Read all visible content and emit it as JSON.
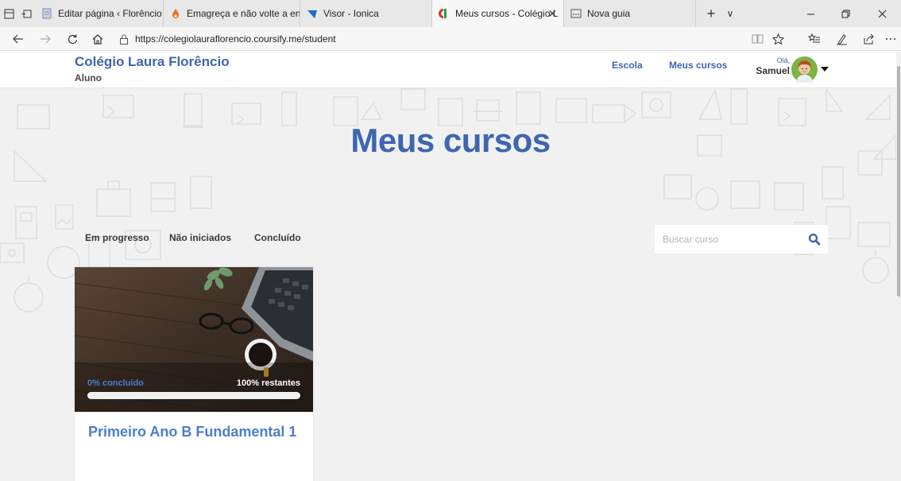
{
  "browser": {
    "tabs": [
      {
        "label": "Editar página ‹ Florêncio Sis",
        "icon": "document-icon",
        "active": false
      },
      {
        "label": "Emagreça e não volte a eng",
        "icon": "flame-icon",
        "active": false
      },
      {
        "label": "Visor - Ionica",
        "icon": "ionica-icon",
        "active": false
      },
      {
        "label": "Meus cursos - Colégio L",
        "icon": "coursify-icon",
        "active": true
      },
      {
        "label": "Nova guia",
        "icon": "newtab-icon",
        "active": false
      }
    ],
    "close_tab_glyph": "✕",
    "new_tab_glyph": "+",
    "tab_list_glyph": "∨",
    "url": "https://colegiolauraflorencio.coursify.me/student",
    "accent_color": "#3e66b0"
  },
  "site": {
    "brand_name": "Colégio Laura Florêncio",
    "brand_sub": "Aluno",
    "nav": {
      "school": "Escola",
      "my_courses": "Meus cursos"
    },
    "user": {
      "greeting": "Olá,",
      "name": "Samuel"
    }
  },
  "hero": {
    "title": "Meus cursos"
  },
  "filters": {
    "in_progress": "Em progresso",
    "not_started": "Não iniciados",
    "completed": "Concluído"
  },
  "search": {
    "placeholder": "Buscar curso",
    "value": ""
  },
  "courses": [
    {
      "title": "Primeiro Ano B Fundamental 1",
      "completed_label": "0% concluído",
      "remaining_label": "100% restantes",
      "progress_percent": 0,
      "bar_color": "#4b7ed0"
    }
  ]
}
